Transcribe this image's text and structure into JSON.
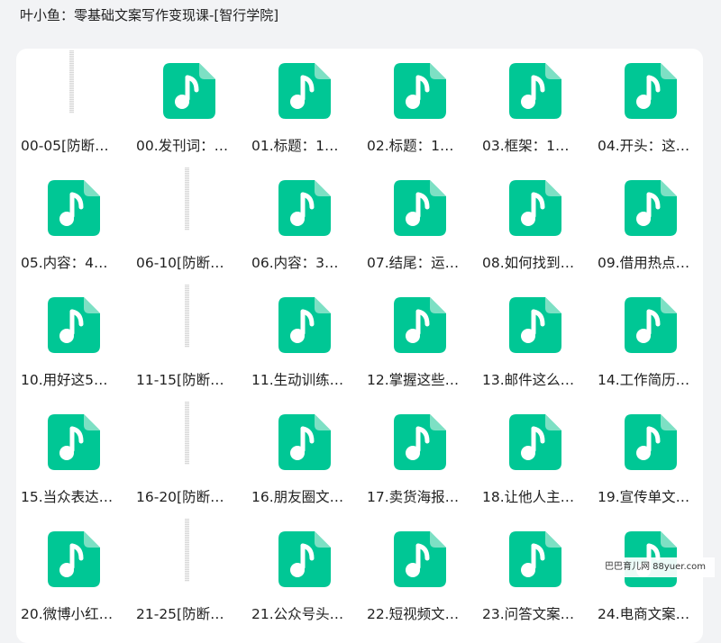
{
  "header": {
    "title": "叶小鱼：零基础文案写作变现课-[智行学院]"
  },
  "colors": {
    "accent": "#00c795",
    "panel": "#ffffff",
    "background": "#f2f3f5"
  },
  "items": [
    {
      "label": "00-05[防断…",
      "icon": "folder-icon"
    },
    {
      "label": "00.发刊词：…",
      "icon": "music-file-icon"
    },
    {
      "label": "01.标题：1…",
      "icon": "music-file-icon"
    },
    {
      "label": "02.标题：1…",
      "icon": "music-file-icon"
    },
    {
      "label": "03.框架：1…",
      "icon": "music-file-icon"
    },
    {
      "label": "04.开头：这…",
      "icon": "music-file-icon"
    },
    {
      "label": "05.内容：4…",
      "icon": "music-file-icon"
    },
    {
      "label": "06-10[防断…",
      "icon": "folder-icon"
    },
    {
      "label": "06.内容：3…",
      "icon": "music-file-icon"
    },
    {
      "label": "07.结尾：运…",
      "icon": "music-file-icon"
    },
    {
      "label": "08.如何找到…",
      "icon": "music-file-icon"
    },
    {
      "label": "09.借用热点…",
      "icon": "music-file-icon"
    },
    {
      "label": "10.用好这5…",
      "icon": "music-file-icon"
    },
    {
      "label": "11-15[防断…",
      "icon": "folder-icon"
    },
    {
      "label": "11.生动训练…",
      "icon": "music-file-icon"
    },
    {
      "label": "12.掌握这些…",
      "icon": "music-file-icon"
    },
    {
      "label": "13.邮件这么…",
      "icon": "music-file-icon"
    },
    {
      "label": "14.工作简历…",
      "icon": "music-file-icon"
    },
    {
      "label": "15.当众表达…",
      "icon": "music-file-icon"
    },
    {
      "label": "16-20[防断…",
      "icon": "folder-icon"
    },
    {
      "label": "16.朋友圈文…",
      "icon": "music-file-icon"
    },
    {
      "label": "17.卖货海报…",
      "icon": "music-file-icon"
    },
    {
      "label": "18.让他人主…",
      "icon": "music-file-icon"
    },
    {
      "label": "19.宣传单文…",
      "icon": "music-file-icon"
    },
    {
      "label": "20.微博小红…",
      "icon": "music-file-icon"
    },
    {
      "label": "21-25[防断…",
      "icon": "folder-icon"
    },
    {
      "label": "21.公众号头…",
      "icon": "music-file-icon"
    },
    {
      "label": "22.短视频文…",
      "icon": "music-file-icon"
    },
    {
      "label": "23.问答文案…",
      "icon": "music-file-icon"
    },
    {
      "label": "24.电商文案…",
      "icon": "music-file-icon"
    }
  ],
  "watermark": {
    "text": "巴巴育儿网 88yuer.com"
  }
}
